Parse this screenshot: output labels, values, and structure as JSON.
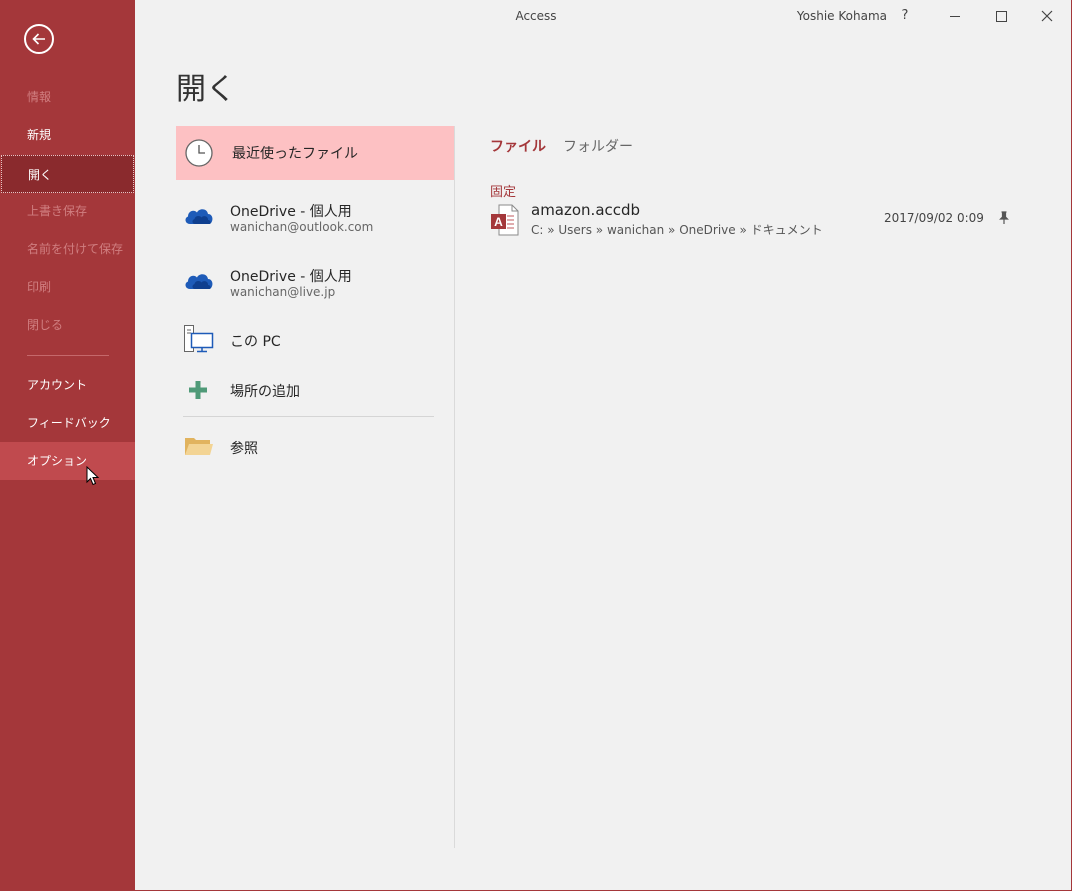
{
  "window": {
    "title": "Access",
    "user": "Yoshie Kohama",
    "help": "?"
  },
  "sidebar": {
    "items": [
      {
        "label": "情報",
        "state": "disabled"
      },
      {
        "label": "新規",
        "state": "normal"
      },
      {
        "label": "開く",
        "state": "selected"
      },
      {
        "label": "上書き保存",
        "state": "disabled"
      },
      {
        "label": "名前を付けて保存",
        "state": "disabled"
      },
      {
        "label": "印刷",
        "state": "disabled"
      },
      {
        "label": "閉じる",
        "state": "disabled"
      },
      {
        "label": "アカウント",
        "state": "normal"
      },
      {
        "label": "フィードバック",
        "state": "normal"
      },
      {
        "label": "オプション",
        "state": "hover"
      }
    ]
  },
  "page": {
    "title": "開く"
  },
  "places": [
    {
      "title": "最近使ったファイル",
      "icon": "clock-icon",
      "selected": true
    },
    {
      "title": "OneDrive - 個人用",
      "subtitle": "wanichan@outlook.com",
      "icon": "onedrive-icon"
    },
    {
      "title": "OneDrive - 個人用",
      "subtitle": "wanichan@live.jp",
      "icon": "onedrive-icon"
    },
    {
      "title": "この PC",
      "icon": "computer-icon"
    },
    {
      "title": "場所の追加",
      "icon": "plus-icon"
    },
    {
      "title": "参照",
      "icon": "folder-icon"
    }
  ],
  "tabs": {
    "files": "ファイル",
    "folders": "フォルダー"
  },
  "pinned": {
    "heading": "固定",
    "files": [
      {
        "name": "amazon.accdb",
        "path": "C: » Users » wanichan » OneDrive » ドキュメント",
        "date": "2017/09/02 0:09",
        "icon": "access-file-icon"
      }
    ]
  },
  "colors": {
    "accent": "#a4373a",
    "selected_place": "#fdc1c3",
    "background": "#f1f1f1"
  }
}
